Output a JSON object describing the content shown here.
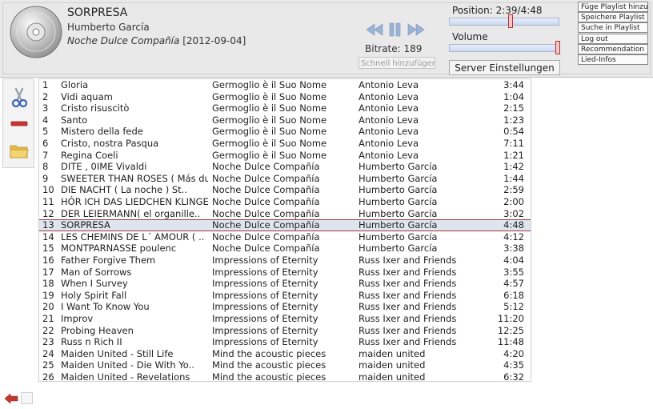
{
  "now_playing": {
    "title": "SORPRESA",
    "artist": "Humberto García",
    "album": "Noche Dulce Compañía",
    "date": "[2012-09-04]",
    "bitrate_label": "Bitrate: 189",
    "position_label": "Position: 2:39/4:48",
    "position_fraction": 0.552,
    "volume_label": "Volume",
    "volume_fraction": 0.98
  },
  "controls": {
    "quick_add_placeholder": "Schnell hinzufügen",
    "server_settings_label": "Server Einstellungen",
    "icons": [
      "rewind-icon",
      "pause-icon",
      "forward-icon"
    ]
  },
  "side_buttons": [
    "Füge Playlist hinzu",
    "Speichere Playlist",
    "Suche in Playlist",
    "Log out",
    "Recommendation",
    "Lied-Infos"
  ],
  "tools": [
    "scissors-icon",
    "remove-icon",
    "folder-icon"
  ],
  "playlist": {
    "selected_index": 12,
    "rows": [
      {
        "num": "1",
        "title": "Gloria",
        "album": "Germoglio è il Suo Nome",
        "artist": "Antonio Leva",
        "time": "3:44"
      },
      {
        "num": "2",
        "title": "Vidi aquam",
        "album": "Germoglio è il Suo Nome",
        "artist": "Antonio Leva",
        "time": "1:04"
      },
      {
        "num": "3",
        "title": "Cristo risuscitò",
        "album": "Germoglio è il Suo Nome",
        "artist": "Antonio Leva",
        "time": "2:15"
      },
      {
        "num": "4",
        "title": "Santo",
        "album": "Germoglio è il Suo Nome",
        "artist": "Antonio Leva",
        "time": "1:23"
      },
      {
        "num": "5",
        "title": "Mistero della fede",
        "album": "Germoglio è il Suo Nome",
        "artist": "Antonio Leva",
        "time": "0:54"
      },
      {
        "num": "6",
        "title": "Cristo, nostra Pasqua",
        "album": "Germoglio è il Suo Nome",
        "artist": "Antonio Leva",
        "time": "7:11"
      },
      {
        "num": "7",
        "title": "Regina Coeli",
        "album": "Germoglio è il Suo Nome",
        "artist": "Antonio Leva",
        "time": "1:21"
      },
      {
        "num": "8",
        "title": "DITE , 0IME Vivaldi",
        "album": "Noche Dulce Compañía",
        "artist": "Humberto García",
        "time": "1:42"
      },
      {
        "num": "9",
        "title": "SWEETER THAN ROSES ( Más du..",
        "album": "Noche Dulce Compañía",
        "artist": "Humberto García",
        "time": "1:44"
      },
      {
        "num": "10",
        "title": "DIE NACHT ( La noche ) St..",
        "album": "Noche Dulce Compañía",
        "artist": "Humberto García",
        "time": "2:59"
      },
      {
        "num": "11",
        "title": "HÓR ICH DAS LIEDCHEN KLINGE..",
        "album": "Noche Dulce Compañía",
        "artist": "Humberto García",
        "time": "2:00"
      },
      {
        "num": "12",
        "title": "DER LEIERMANN( el organille..",
        "album": "Noche Dulce Compañía",
        "artist": "Humberto García",
        "time": "3:02"
      },
      {
        "num": "13",
        "title": "SORPRESA",
        "album": "Noche Dulce Compañía",
        "artist": "Humberto García",
        "time": "4:48"
      },
      {
        "num": "14",
        "title": "LES CHEMINS DE L´ AMOUR ( ..",
        "album": "Noche Dulce Compañía",
        "artist": "Humberto García",
        "time": "4:12"
      },
      {
        "num": "15",
        "title": "MONTPARNASSE poulenc",
        "album": "Noche Dulce Compañía",
        "artist": "Humberto García",
        "time": "3:38"
      },
      {
        "num": "16",
        "title": "Father Forgive Them",
        "album": "Impressions of Eternity",
        "artist": "Russ Ixer and Friends",
        "time": "4:04"
      },
      {
        "num": "17",
        "title": "Man of Sorrows",
        "album": "Impressions of Eternity",
        "artist": "Russ Ixer and Friends",
        "time": "3:55"
      },
      {
        "num": "18",
        "title": "When I Survey",
        "album": "Impressions of Eternity",
        "artist": "Russ Ixer and Friends",
        "time": "4:57"
      },
      {
        "num": "19",
        "title": "Holy Spirit Fall",
        "album": "Impressions of Eternity",
        "artist": "Russ Ixer and Friends",
        "time": "6:18"
      },
      {
        "num": "20",
        "title": "I Want To Know You",
        "album": "Impressions of Eternity",
        "artist": "Russ Ixer and Friends",
        "time": "5:12"
      },
      {
        "num": "21",
        "title": "Improv",
        "album": "Impressions of Eternity",
        "artist": "Russ Ixer and Friends",
        "time": "11:20"
      },
      {
        "num": "22",
        "title": "Probing Heaven",
        "album": "Impressions of Eternity",
        "artist": "Russ Ixer and Friends",
        "time": "12:25"
      },
      {
        "num": "23",
        "title": "Russ n Rich II",
        "album": "Impressions of Eternity",
        "artist": "Russ Ixer and Friends",
        "time": "11:48"
      },
      {
        "num": "24",
        "title": "Maiden United - Still Life",
        "album": "Mind the acoustic pieces",
        "artist": "maiden united",
        "time": "4:20"
      },
      {
        "num": "25",
        "title": "Maiden United - Die With Yo..",
        "album": "Mind the acoustic pieces",
        "artist": "maiden united",
        "time": "4:35"
      },
      {
        "num": "26",
        "title": "Maiden United - Revelations",
        "album": "Mind the acoustic pieces",
        "artist": "maiden united",
        "time": "6:32"
      }
    ]
  },
  "bottom": {
    "icons": [
      "back-arrow-icon",
      "blank-icon"
    ]
  }
}
